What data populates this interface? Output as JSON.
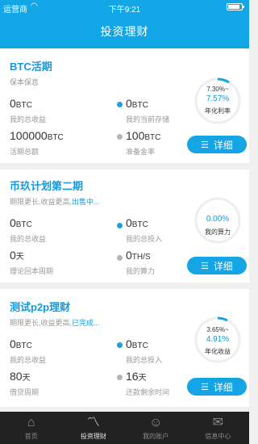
{
  "status_bar": {
    "carrier": "运营商",
    "time": "下午9:21"
  },
  "header": {
    "title": "投资理财"
  },
  "products": [
    {
      "title": "BTC活期",
      "subtitle": "保本保息",
      "subtitle_highlight": "",
      "ring": {
        "line1": "7.30%~",
        "line2": "7.57%",
        "line3": "年化利率"
      },
      "stats": [
        {
          "value": "0",
          "unit": "BTC",
          "label": "我的总收益"
        },
        {
          "value": "0",
          "unit": "BTC",
          "label": "我的当前存储"
        },
        {
          "value": "100000",
          "unit": "BTC",
          "label": "活期总额"
        },
        {
          "value": "100",
          "unit": "BTC",
          "label": "准备金率"
        }
      ],
      "button": "详细"
    },
    {
      "title": "币玖计划第二期",
      "subtitle": "期限更长,收益更高,",
      "subtitle_highlight": "出售中...",
      "ring": {
        "line1": "",
        "line2": "0.00%",
        "line3": "我的算力"
      },
      "stats": [
        {
          "value": "0",
          "unit": "BTC",
          "label": "我的总收益"
        },
        {
          "value": "0",
          "unit": "BTC",
          "label": "我的总投入"
        },
        {
          "value": "0",
          "unit": "天",
          "label": "理论回本周期"
        },
        {
          "value": "0",
          "unit": "TH/S",
          "label": "我的算力"
        }
      ],
      "button": "详细"
    },
    {
      "title": "测试p2p理财",
      "subtitle": "期限更长,收益更高,",
      "subtitle_highlight": "已完成...",
      "ring": {
        "line1": "3.65%~",
        "line2": "4.91%",
        "line3": "年化收益"
      },
      "stats": [
        {
          "value": "0",
          "unit": "BTC",
          "label": "我的总收益"
        },
        {
          "value": "0",
          "unit": "BTC",
          "label": "我的总投入"
        },
        {
          "value": "80",
          "unit": "天",
          "label": "借贷周期"
        },
        {
          "value": "16",
          "unit": "天",
          "label": "还款剩余时间"
        }
      ],
      "button": "详细"
    }
  ],
  "tabbar": [
    {
      "label": "首页",
      "icon": "home-icon"
    },
    {
      "label": "投资理财",
      "icon": "trend-icon"
    },
    {
      "label": "我的账户",
      "icon": "user-icon"
    },
    {
      "label": "信息中心",
      "icon": "message-icon"
    }
  ],
  "colors": {
    "accent": "#13a6e6",
    "tabbar": "#222222"
  }
}
